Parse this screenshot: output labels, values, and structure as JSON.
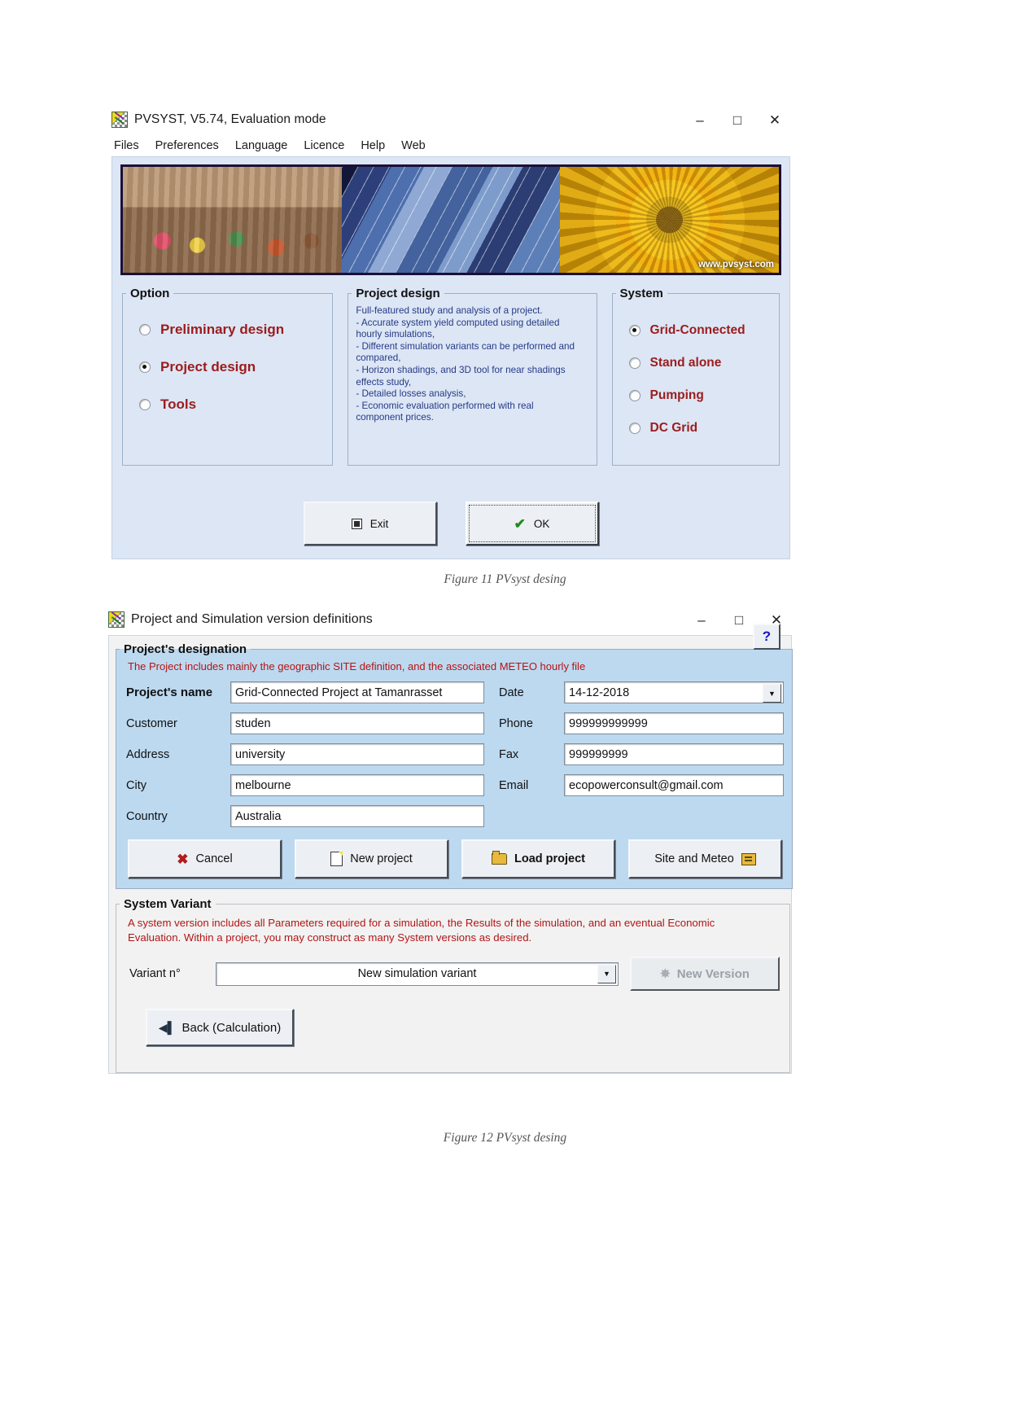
{
  "figure1": {
    "window": {
      "title": "PVSYST, V5.74,  Evaluation mode",
      "icon": "pvsyst-app-icon",
      "minimize": "–",
      "maximize": "□",
      "close": "✕"
    },
    "menu": [
      "Files",
      "Preferences",
      "Language",
      "Licence",
      "Help",
      "Web"
    ],
    "banner": {
      "url_text": "www.pvsyst.com"
    },
    "option_group": {
      "legend": "Option",
      "items": [
        {
          "label": "Preliminary design",
          "selected": false
        },
        {
          "label": "Project design",
          "selected": true
        },
        {
          "label": "Tools",
          "selected": false
        }
      ]
    },
    "project_design_group": {
      "legend": "Project design",
      "lines": [
        "Full-featured study and analysis of a project.",
        "- Accurate system yield computed using detailed",
        "hourly simulations,",
        "- Different simulation variants can be performed and",
        "compared,",
        "- Horizon shadings, and 3D tool for near shadings",
        "effects study,",
        "- Detailed losses analysis,",
        "- Economic evaluation performed with real",
        "component prices."
      ]
    },
    "system_group": {
      "legend": "System",
      "items": [
        {
          "label": "Grid-Connected",
          "selected": true
        },
        {
          "label": "Stand alone",
          "selected": false
        },
        {
          "label": "Pumping",
          "selected": false
        },
        {
          "label": "DC Grid",
          "selected": false
        }
      ]
    },
    "buttons": {
      "exit": "Exit",
      "ok": "OK"
    },
    "caption": "Figure 11 PVsyst desing"
  },
  "figure2": {
    "window": {
      "title": "Project and Simulation version definitions",
      "icon": "pvsyst-app-icon",
      "minimize": "–",
      "maximize": "□",
      "close": "✕"
    },
    "designation": {
      "legend": "Project's designation",
      "info": "The Project includes mainly the geographic SITE definition, and the associated  METEO  hourly file",
      "help_label": "?",
      "left_fields": [
        {
          "label": "Project's name",
          "value": "Grid-Connected Project at Tamanrasset",
          "bold": true
        },
        {
          "label": "Customer",
          "value": "studen",
          "bold": false
        },
        {
          "label": "Address",
          "value": "university",
          "bold": false
        },
        {
          "label": "City",
          "value": "melbourne",
          "bold": false
        },
        {
          "label": "Country",
          "value": "Australia",
          "bold": false
        }
      ],
      "right_fields": [
        {
          "label": "Date",
          "value": "14-12-2018",
          "combo": true
        },
        {
          "label": "Phone",
          "value": "999999999999",
          "combo": false
        },
        {
          "label": "Fax",
          "value": "999999999",
          "combo": false
        },
        {
          "label": "Email",
          "value": "ecopowerconsult@gmail.com",
          "combo": false
        }
      ],
      "actions": [
        {
          "label": "Cancel",
          "icon": "cross-icon"
        },
        {
          "label": "New project",
          "icon": "new-page-icon"
        },
        {
          "label": "Load project",
          "icon": "open-folder-icon"
        },
        {
          "label": "Site and Meteo",
          "icon": "pointing-hand-icon"
        }
      ]
    },
    "system_variant": {
      "legend": "System Variant",
      "info_line_1": "A system version includes all Parameters required for a simulation, the Results of the simulation, and an eventual Economic",
      "info_line_2": "Evaluation.  Within a project, you may construct as many System versions as desired.",
      "variant_label": "Variant n°",
      "variant_value": "New simulation variant",
      "new_version_label": "New Version",
      "back_label": "Back (Calculation)"
    },
    "caption": "Figure 12 PVsyst desing"
  },
  "colors": {
    "window_body": "#dce6f5",
    "section_blue": "#bcd9f0",
    "radio_red": "#9b1c1c",
    "desc_blue": "#273a86",
    "info_red": "#b31515"
  }
}
